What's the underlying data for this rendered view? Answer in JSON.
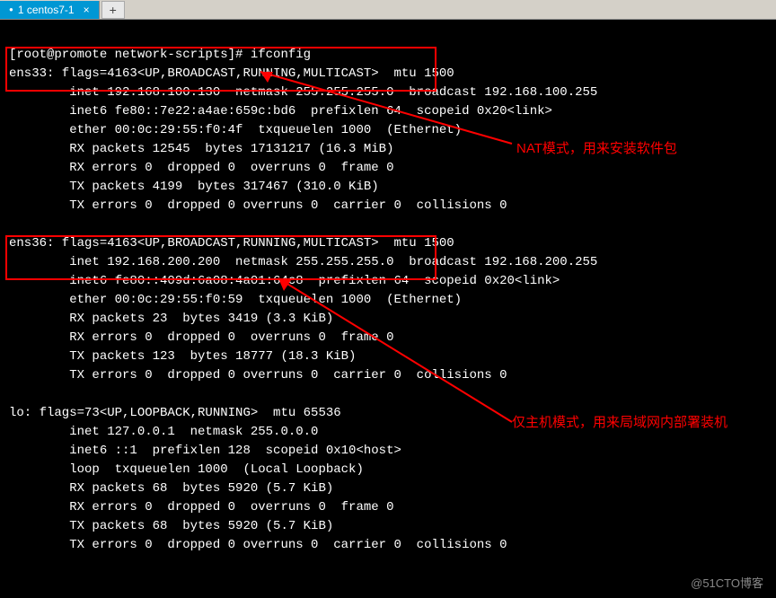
{
  "tabs": {
    "active": {
      "label": "1 centos7-1"
    },
    "add": "+"
  },
  "prompt": "[root@promote network-scripts]# ",
  "cmd": "ifconfig",
  "ens33": {
    "l0": "ens33: flags=4163<UP,BROADCAST,RUNNING,MULTICAST>  mtu 1500",
    "l1": "        inet 192.168.100.130  netmask 255.255.255.0  broadcast 192.168.100.255",
    "l2": "        inet6 fe80::7e22:a4ae:659c:bd6  prefixlen 64  scopeid 0x20<link>",
    "l3": "        ether 00:0c:29:55:f0:4f  txqueuelen 1000  (Ethernet)",
    "l4": "        RX packets 12545  bytes 17131217 (16.3 MiB)",
    "l5": "        RX errors 0  dropped 0  overruns 0  frame 0",
    "l6": "        TX packets 4199  bytes 317467 (310.0 KiB)",
    "l7": "        TX errors 0  dropped 0 overruns 0  carrier 0  collisions 0"
  },
  "ens36": {
    "l0": "ens36: flags=4163<UP,BROADCAST,RUNNING,MULTICAST>  mtu 1500",
    "l1": "        inet 192.168.200.200  netmask 255.255.255.0  broadcast 192.168.200.255",
    "l2": "        inet6 fe80::409d:6a08:4a01:64c8  prefixlen 64  scopeid 0x20<link>",
    "l3": "        ether 00:0c:29:55:f0:59  txqueuelen 1000  (Ethernet)",
    "l4": "        RX packets 23  bytes 3419 (3.3 KiB)",
    "l5": "        RX errors 0  dropped 0  overruns 0  frame 0",
    "l6": "        TX packets 123  bytes 18777 (18.3 KiB)",
    "l7": "        TX errors 0  dropped 0 overruns 0  carrier 0  collisions 0"
  },
  "lo": {
    "l0": "lo: flags=73<UP,LOOPBACK,RUNNING>  mtu 65536",
    "l1": "        inet 127.0.0.1  netmask 255.0.0.0",
    "l2": "        inet6 ::1  prefixlen 128  scopeid 0x10<host>",
    "l3": "        loop  txqueuelen 1000  (Local Loopback)",
    "l4": "        RX packets 68  bytes 5920 (5.7 KiB)",
    "l5": "        RX errors 0  dropped 0  overruns 0  frame 0",
    "l6": "        TX packets 68  bytes 5920 (5.7 KiB)",
    "l7": "        TX errors 0  dropped 0 overruns 0  carrier 0  collisions 0"
  },
  "annotation1": "NAT模式，用来安装软件包",
  "annotation2": "仅主机模式，用来局域网内部署装机",
  "watermark": "@51CTO博客"
}
